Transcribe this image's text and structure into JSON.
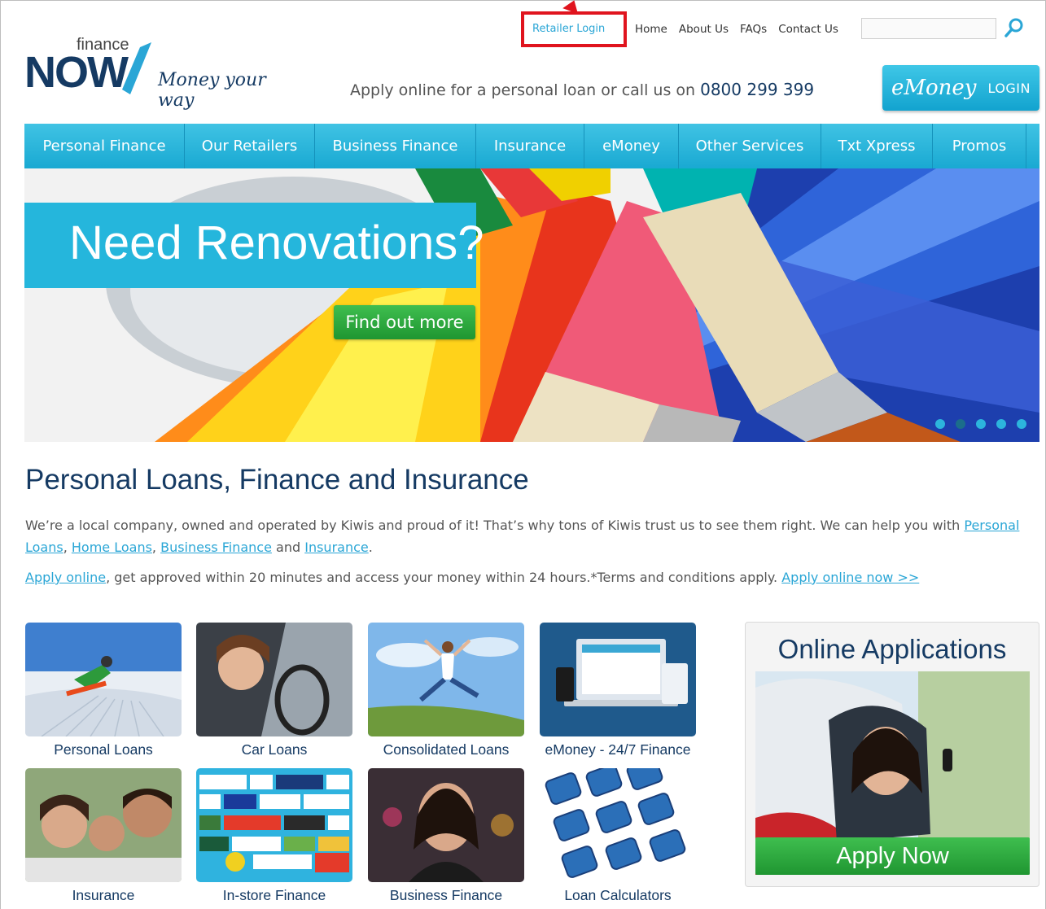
{
  "header": {
    "retailer_login": "Retailer Login",
    "top_links": [
      "Home",
      "About Us",
      "FAQs",
      "Contact Us"
    ],
    "search_placeholder": "",
    "logo": {
      "finance": "finance",
      "now": "NOW",
      "tagline": "Money your way"
    },
    "apply_text": "Apply online for a personal loan or call us on",
    "phone": "0800 299 399",
    "emoney_button": {
      "brand": "eMoney",
      "login": "LOGIN"
    }
  },
  "nav": {
    "items": [
      "Personal Finance",
      "Our Retailers",
      "Business Finance",
      "Insurance",
      "eMoney",
      "Other Services",
      "Txt Xpress",
      "Promos"
    ]
  },
  "hero": {
    "title": "Need Renovations?",
    "button": "Find out more",
    "slides_count": 5,
    "active_slide": 2
  },
  "main": {
    "title": "Personal Loans, Finance and Insurance",
    "intro_prefix": "We’re a local company, owned and operated by Kiwis and proud of it! That’s why tons of Kiwis trust us to see them right. We can help you with",
    "intro_links": [
      "Personal Loans",
      "Home Loans",
      "Business Finance",
      "Insurance"
    ],
    "apply_link": "Apply online",
    "apply_text": ", get approved within 20 minutes and access your money within 24 hours.*Terms and conditions apply.",
    "apply_now_link": "Apply online now >>"
  },
  "tiles": [
    "Personal Loans",
    "Car Loans",
    "Consolidated Loans",
    "eMoney - 24/7 Finance",
    "Insurance",
    "In-store Finance",
    "Business Finance",
    "Loan Calculators"
  ],
  "online_applications": {
    "title": "Online Applications",
    "button": "Apply Now"
  },
  "colors": {
    "brand_navy": "#153a63",
    "brand_cyan": "#25b6dc",
    "cta_green": "#26a038",
    "highlight_red": "#e0141e"
  }
}
